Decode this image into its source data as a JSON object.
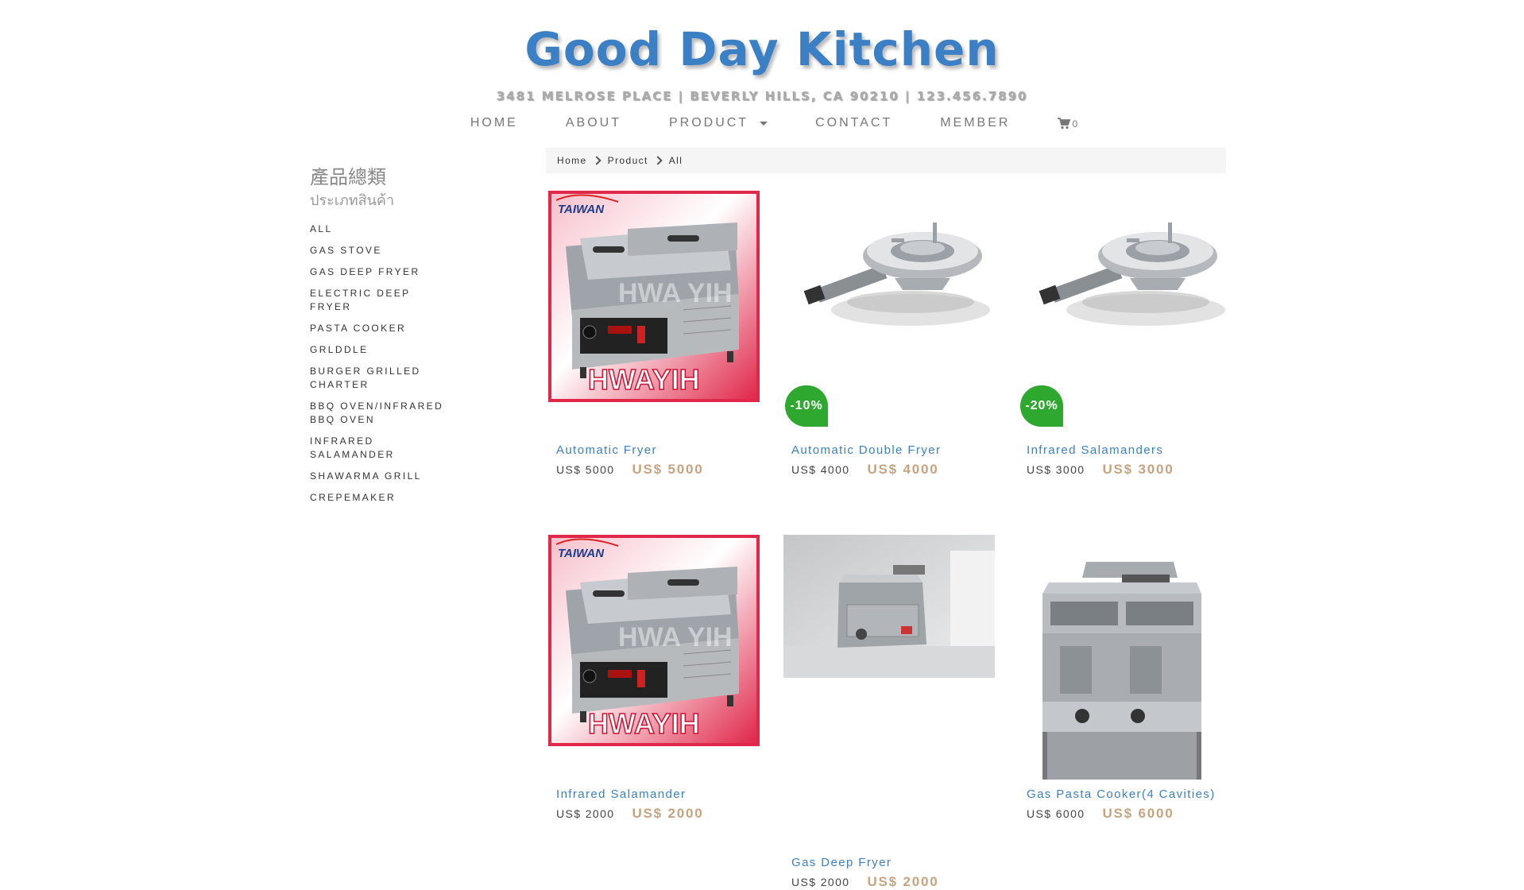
{
  "site": {
    "title": "Good Day Kitchen",
    "address": "3481 MELROSE PLACE | BEVERLY HILLS, CA 90210 | 123.456.7890"
  },
  "nav": {
    "items": [
      "HOME",
      "ABOUT",
      "PRODUCT",
      "CONTACT",
      "MEMBER"
    ],
    "cart_icon": "shopping-cart-icon",
    "cart_count": "0"
  },
  "sidebar": {
    "title_zh": "產品總類",
    "title_th": "ประเภทสินค้า",
    "categories": [
      "ALL",
      "GAS STOVE",
      "GAS DEEP FRYER",
      "ELECTRIC DEEP FRYER",
      "PASTA COOKER",
      "GRLDDLE",
      "BURGER GRILLED CHARTER",
      "BBQ OVEN/INFRARED BBQ OVEN",
      "INFRARED SALAMANDER",
      "SHAWARMA GRILL",
      "CREPEMAKER"
    ]
  },
  "breadcrumb": [
    "Home",
    "Product",
    "All"
  ],
  "products": [
    {
      "name": "Automatic Fryer",
      "old_price": "US$ 5000",
      "price": "US$ 5000",
      "badge": "",
      "image": "griddle-taiwan-hwayih"
    },
    {
      "name": "Automatic Double Fryer",
      "old_price": "US$ 4000",
      "price": "US$ 4000",
      "badge": "-10%",
      "image": "gas-burner"
    },
    {
      "name": "Infrared Salamanders",
      "old_price": "US$ 3000",
      "price": "US$ 3000",
      "badge": "-20%",
      "image": "gas-burner"
    },
    {
      "name": "Infrared Salamander",
      "old_price": "US$ 2000",
      "price": "US$ 2000",
      "badge": "",
      "image": "griddle-taiwan-hwayih"
    },
    {
      "name": "Gas Deep Fryer",
      "old_price": "US$ 2000",
      "price": "US$ 2000",
      "badge": "",
      "image": "countertop-deep-fryer"
    },
    {
      "name": "Gas Pasta Cooker(4 Cavities)",
      "old_price": "US$ 6000",
      "price": "US$ 6000",
      "badge": "",
      "image": "floor-pasta-cooker"
    }
  ],
  "image_text": {
    "taiwan_logo": "TAIWAN",
    "brand_logo": "HWAYIH",
    "watermark": "HWA YIH"
  },
  "colors": {
    "title": "#3b7fc4",
    "link": "#3b7fc4",
    "price": "#c9a27e",
    "badge": "#2fa82f",
    "image_frame": "#e0284a"
  }
}
